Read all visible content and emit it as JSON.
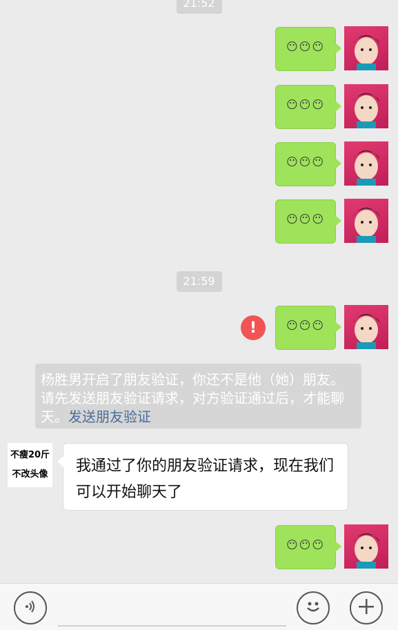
{
  "timestamps": [
    "21:52",
    "21:59"
  ],
  "my_messages": [
    {
      "emoji_text": "😶😶😶"
    },
    {
      "emoji_text": "😶😶😶"
    },
    {
      "emoji_text": "😶😶😶"
    },
    {
      "emoji_text": "😶😶😶"
    },
    {
      "emoji_text": "😶😶😶"
    },
    {
      "emoji_text": "😶😶😶"
    }
  ],
  "failed_send_icon": "!",
  "system_message": {
    "text": "杨胜男开启了朋友验证，你还不是他（她）朋友。请先发送朋友验证请求，对方验证通过后，才能聊天。",
    "link": "发送朋友验证"
  },
  "their_avatar": {
    "line1": "不瘦20斤",
    "line2": "不改头像"
  },
  "their_message": "我通过了你的朋友验证请求，现在我们可以开始聊天了",
  "icons": {
    "voice": "voice-icon",
    "emoji": "emoji-icon",
    "plus": "plus-icon"
  },
  "colors": {
    "my_bubble": "#9ee35a",
    "system_link": "#4a6d9a",
    "error": "#f05454"
  }
}
